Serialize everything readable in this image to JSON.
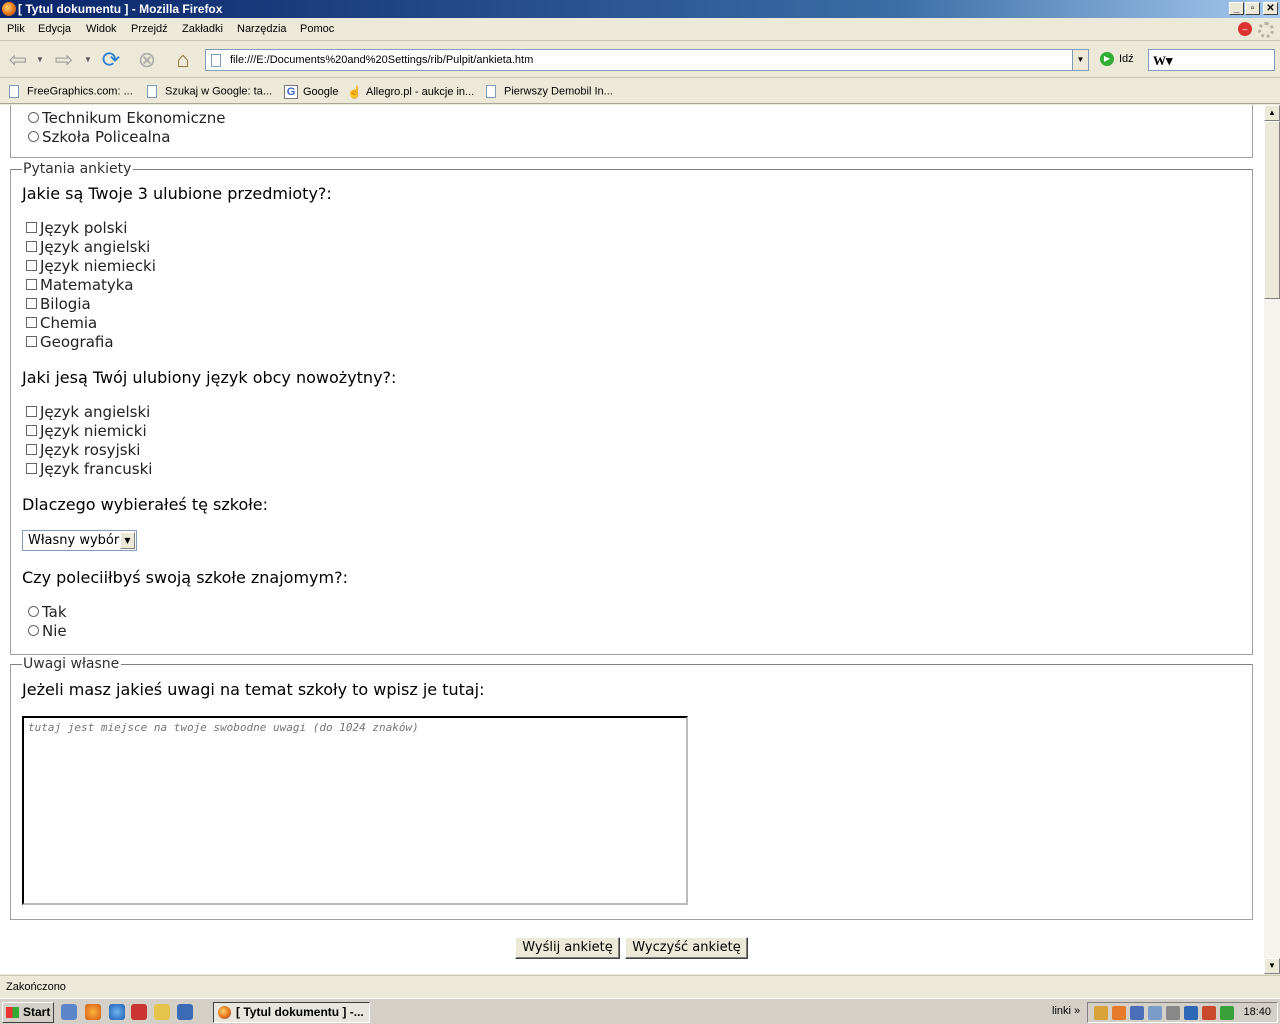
{
  "window": {
    "title": "[ Tytul dokumentu ] - Mozilla Firefox",
    "buttons": [
      "_",
      "▫",
      "✕"
    ]
  },
  "menu": [
    "Plik",
    "Edycja",
    "Widok",
    "Przejdź",
    "Zakładki",
    "Narzędzia",
    "Pomoc"
  ],
  "nav": {
    "url": "file:///E:/Documents%20and%20Settings/rib/Pulpit/ankieta.htm",
    "go_label": "Idź"
  },
  "bookmarks": [
    "FreeGraphics.com: ...",
    "Szukaj w Google: ta...",
    "Google",
    "Allegro.pl - aukcje in...",
    "Pierwszy Demobil In..."
  ],
  "page": {
    "top_options": [
      "Technikum Ekonomiczne",
      "Szkoła Policealna"
    ],
    "questions_legend": "Pytania ankiety",
    "q1": "Jakie są Twoje 3 ulubione przedmioty?:",
    "q1_options": [
      "Język polski",
      "Język angielski",
      "Język niemiecki",
      "Matematyka",
      "Bilogia",
      "Chemia",
      "Geografia"
    ],
    "q2": "Jaki jesą Twój ulubiony język obcy nowożytny?:",
    "q2_options": [
      "Język angielski",
      "Język niemicki",
      "Język rosyjski",
      "Język francuski"
    ],
    "q3": "Dlaczego wybierałeś tę szkołe:",
    "q3_select_value": "Własny wybór",
    "q4": "Czy poleciiłbyś swoją szkołe znajomym?:",
    "q4_options": [
      "Tak",
      "Nie"
    ],
    "remarks_legend": "Uwagi własne",
    "q5": "Jeżeli masz jakieś uwagi na temat szkoły to wpisz je tutaj:",
    "textarea_placeholder": "tutaj jest miejsce na twoje swobodne uwagi (do 1024 znaków)",
    "submit_label": "Wyślij ankietę",
    "reset_label": "Wyczyść ankietę"
  },
  "status": "Zakończono",
  "taskbar": {
    "start": "Start",
    "task": "[ Tytul dokumentu ] -...",
    "links": "linki",
    "links_chevron": "»",
    "clock": "18:40"
  }
}
